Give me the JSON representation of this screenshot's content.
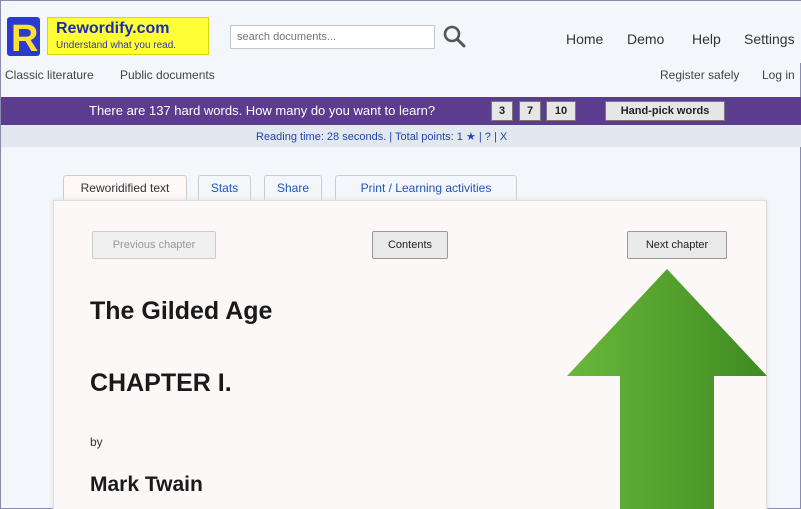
{
  "header": {
    "logo_title": "Rewordify.com",
    "logo_subtitle": "Understand what you read.",
    "search_placeholder": "search documents...",
    "nav": [
      "Home",
      "Demo",
      "Help",
      "Settings"
    ]
  },
  "subnav": {
    "left": [
      "Classic literature",
      "Public documents"
    ],
    "right": [
      "Register safely",
      "Log in"
    ]
  },
  "learn_bar": {
    "prompt": "There are 137 hard words. How many do you want to learn?",
    "options": [
      "3",
      "7",
      "10"
    ],
    "handpick": "Hand-pick words"
  },
  "reading": {
    "text": "Reading time: 28 seconds. | Total points: 1",
    "star": "★",
    "links": " | ? | X"
  },
  "tabs": [
    "Reworidified text",
    "Stats",
    "Share",
    "Print / Learning activities"
  ],
  "content": {
    "prev_chapter": "Previous chapter",
    "contents": "Contents",
    "next_chapter": "Next chapter",
    "book_title": "The Gilded Age",
    "chapter": "CHAPTER I.",
    "by": "by",
    "author": "Mark Twain"
  },
  "colors": {
    "purple_bar": "#5b3c8f",
    "logo_yellow": "#ffff33",
    "arrow_green": "#4f9a2a"
  }
}
